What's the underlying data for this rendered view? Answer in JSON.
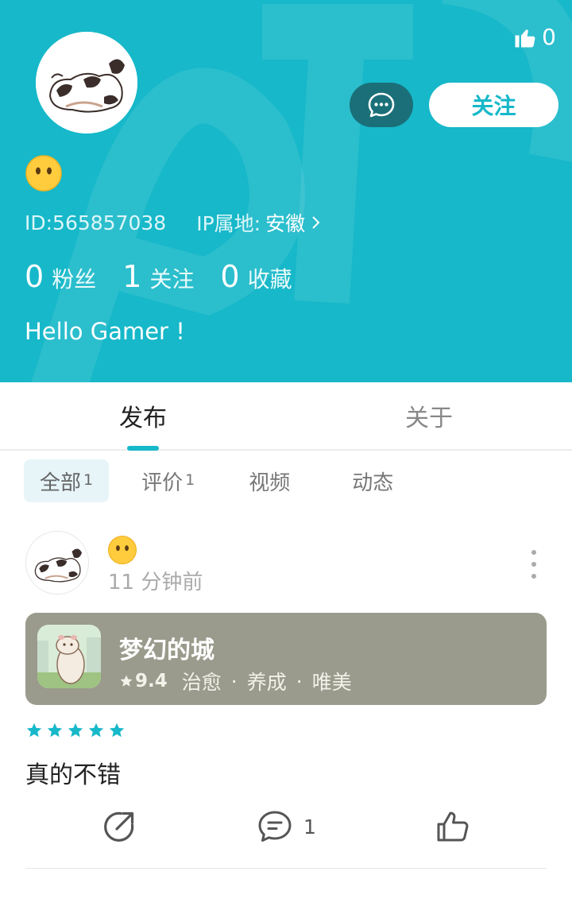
{
  "header": {
    "likes_count": "0",
    "follow_label": "关注",
    "id_text": "ID:565857038",
    "ip_label": "IP属地:",
    "ip_location": "安徽",
    "stats": [
      {
        "num": "0",
        "label": "粉丝"
      },
      {
        "num": "1",
        "label": "关注"
      },
      {
        "num": "0",
        "label": "收藏"
      }
    ],
    "bio": "Hello Gamer !"
  },
  "tabs": [
    {
      "label": "发布",
      "active": true
    },
    {
      "label": "关于",
      "active": false
    }
  ],
  "filters": [
    {
      "label": "全部",
      "count": "1"
    },
    {
      "label": "评价",
      "count": "1"
    },
    {
      "label": "视频",
      "count": ""
    },
    {
      "label": "动态",
      "count": ""
    }
  ],
  "post": {
    "time": "11 分钟前",
    "game": {
      "name": "梦幻的城",
      "score": "9.4",
      "tags": [
        "治愈",
        "养成",
        "唯美"
      ]
    },
    "rating": 5,
    "review": "真的不错",
    "comment_count": "1"
  },
  "colors": {
    "accent": "#16b8c9",
    "game_card": "#9a9b8c",
    "message_button": "#1a6f78"
  }
}
